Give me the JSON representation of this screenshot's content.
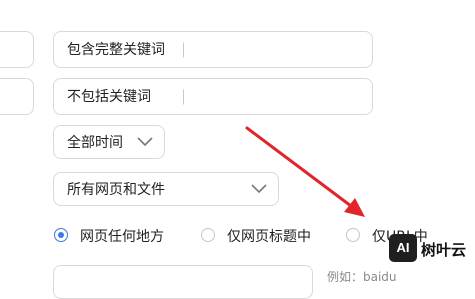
{
  "include_keywords_field": {
    "value": "包含完整关键词"
  },
  "exclude_keywords_field": {
    "value": "不包括关键词"
  },
  "time_filter": {
    "value": "全部时间"
  },
  "page_type_filter": {
    "value": "所有网页和文件"
  },
  "search_scope": {
    "options": [
      {
        "label": "网页任何地方",
        "checked": true
      },
      {
        "label": "仅网页标题中",
        "checked": false
      },
      {
        "label": "仅URL中",
        "checked": false
      }
    ]
  },
  "site_field": {
    "hint": "例如：baidu"
  },
  "watermark": {
    "badge": "AI",
    "text": "树叶云"
  },
  "colors": {
    "accent_blue": "#3b78e7",
    "arrow_red": "#e2242b",
    "border": "#d9d9d9"
  }
}
